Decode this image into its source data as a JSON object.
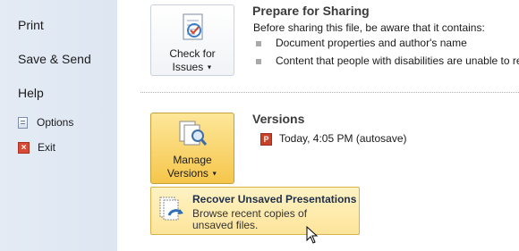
{
  "nav": {
    "print": "Print",
    "save_send": "Save & Send",
    "help": "Help",
    "options": "Options",
    "exit": "Exit"
  },
  "check_button": {
    "line1": "Check for",
    "line2": "Issues"
  },
  "sharing": {
    "title": "Prepare for Sharing",
    "intro": "Before sharing this file, be aware that it contains:",
    "items": [
      "Document properties and author's name",
      "Content that people with disabilities are unable to re"
    ]
  },
  "manage_button": {
    "line1": "Manage",
    "line2": "Versions"
  },
  "versions": {
    "title": "Versions",
    "entry": "Today, 4:05 PM (autosave)"
  },
  "dropdown": {
    "title": "Recover Unsaved Presentations",
    "desc1": "Browse recent copies of",
    "desc2": "unsaved files."
  }
}
